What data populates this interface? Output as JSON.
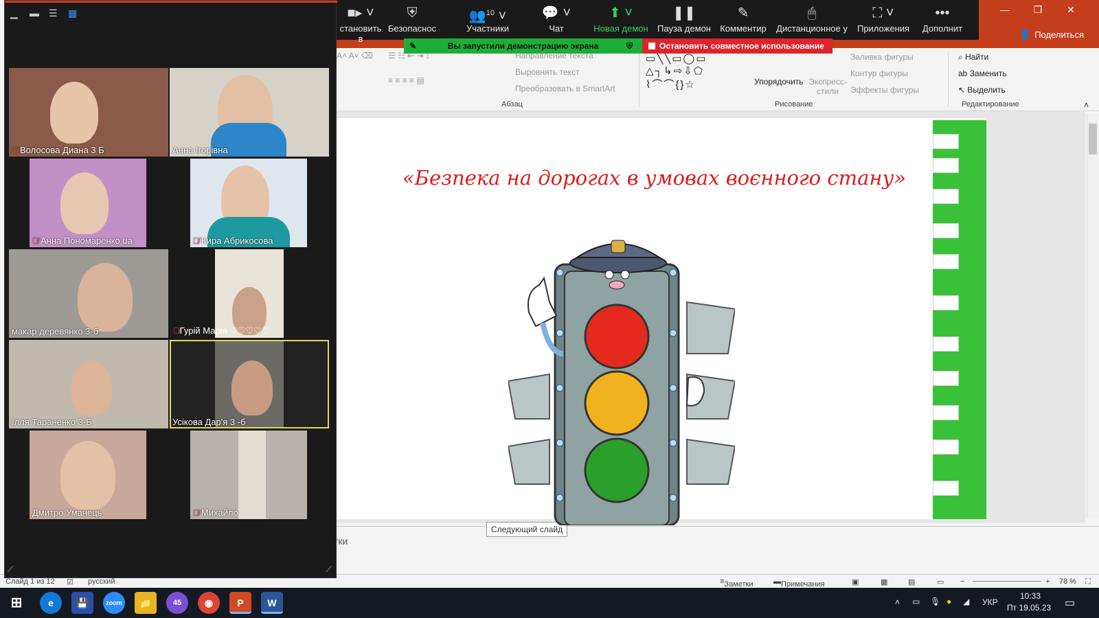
{
  "powerpoint": {
    "share_label": "Поделиться",
    "ribbon": {
      "text_direction": "Направление текста",
      "align_text": "Выровнять текст",
      "smartart": "Преобразовать в SmartArt",
      "group_paragraph": "Абзац",
      "arrange": "Упорядочить",
      "quick_styles": "Экспресс-стили",
      "shape_fill": "Заливка фигуры",
      "shape_outline": "Контур фигуры",
      "shape_effects": "Эффекты фигуры",
      "group_drawing": "Рисование",
      "find": "Найти",
      "replace": "Заменить",
      "select": "Выделить",
      "group_editing": "Редактирование"
    },
    "slide_title": "«Безпека на дорогах в умовах воєнного стану»",
    "tooltip": "Следующий слайд",
    "notes_placeholder": "тки",
    "status": {
      "slide_counter": "Слайд 1 из 12",
      "language": "русский",
      "notes": "Заметки",
      "comments": "Примечания",
      "zoom": "78 %"
    }
  },
  "zoom_toolbar": {
    "items": [
      {
        "label": "становить в",
        "icon": "video-camera-icon"
      },
      {
        "label": "Безопаснос",
        "icon": "shield-icon"
      },
      {
        "label": "Участники",
        "icon": "participants-icon",
        "count": "10"
      },
      {
        "label": "Чат",
        "icon": "chat-icon"
      },
      {
        "label": "Новая демон",
        "icon": "share-screen-icon"
      },
      {
        "label": "Пауза демон",
        "icon": "pause-icon"
      },
      {
        "label": "Комментир",
        "icon": "pencil-icon"
      },
      {
        "label": "Дистанционное у",
        "icon": "mouse-icon"
      },
      {
        "label": "Приложения",
        "icon": "apps-icon"
      },
      {
        "label": "Дополнит",
        "icon": "more-icon"
      }
    ],
    "share_banner": "Вы запустили демонстрацию экрана",
    "stop_banner": "Остановить совместное использование"
  },
  "gallery": {
    "participants": [
      {
        "name": "Волосова Диана 3 Б",
        "muted": true
      },
      {
        "name": "Анна Ігорівна",
        "muted": false
      },
      {
        "name": "Анна Пономаренко ua",
        "muted": true
      },
      {
        "name": "Кира Абрикосова",
        "muted": true
      },
      {
        "name": "макар деревянко 3-б",
        "muted": false
      },
      {
        "name": "Гурій Марія ♡♡♡♡♡",
        "muted": true
      },
      {
        "name": "Ілля Тараненко 3-Б",
        "muted": false
      },
      {
        "name": "Усікова Дар'я 3 -б",
        "muted": false
      },
      {
        "name": "Дмитро Уманець",
        "muted": false
      },
      {
        "name": "Михайло",
        "muted": true
      }
    ]
  },
  "taskbar": {
    "apps": [
      {
        "name": "edge",
        "label": "e"
      },
      {
        "name": "save",
        "label": "💾"
      },
      {
        "name": "zoom",
        "label": "zoom"
      },
      {
        "name": "explorer",
        "label": "📁"
      },
      {
        "name": "viber",
        "label": "45"
      },
      {
        "name": "chrome",
        "label": "◉"
      },
      {
        "name": "powerpoint",
        "label": "P"
      },
      {
        "name": "word",
        "label": "W"
      }
    ],
    "language": "УКР",
    "time": "10:33",
    "date": "Пт 19.05.23"
  }
}
